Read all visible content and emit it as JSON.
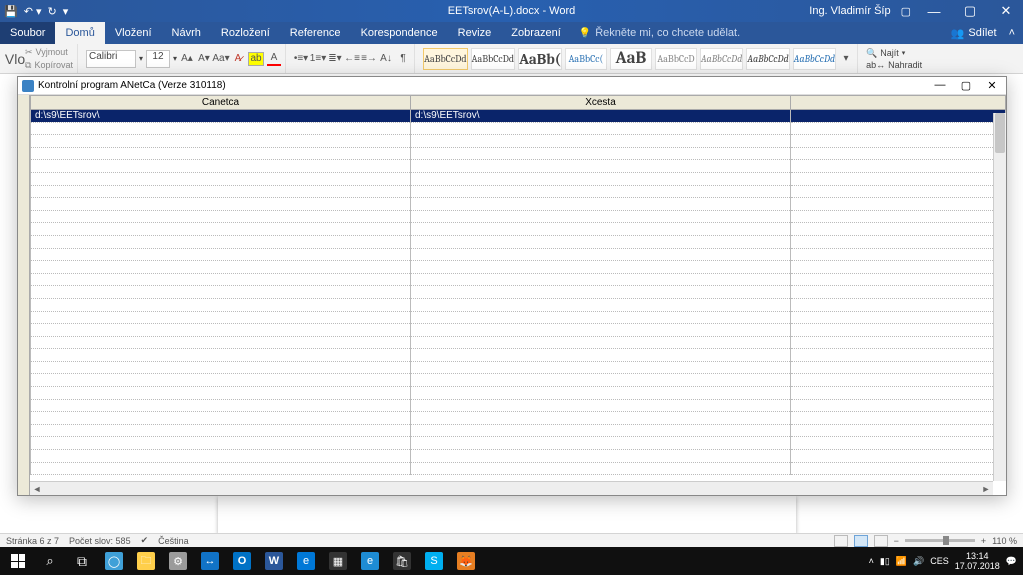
{
  "titlebar": {
    "doc_title": "EETsrov(A-L).docx - Word",
    "user_name": "Ing. Vladimír Šíp"
  },
  "menu": {
    "file": "Soubor",
    "home": "Domů",
    "insert": "Vložení",
    "design": "Návrh",
    "layout": "Rozložení",
    "references": "Reference",
    "mailings": "Korespondence",
    "review": "Revize",
    "view": "Zobrazení",
    "tell_me": "Řekněte mi, co chcete udělat.",
    "share": "Sdílet"
  },
  "ribbon": {
    "clipboard": {
      "cut": "Vyjmout",
      "copy": "Kopírovat",
      "paste_hint": "Vlo"
    },
    "font": {
      "name": "Calibri",
      "size": "12"
    },
    "styles": {
      "s1": "AaBbCcDd",
      "s2": "AaBbCcDd",
      "s3": "AaBb(",
      "s4": "AaBbCc(",
      "s5": "AaB",
      "s6": "AaBbCcD",
      "s7": "AaBbCcDd",
      "s8": "AaBbCcDd",
      "s9": "AaBbCcDd"
    },
    "editing": {
      "find": "Najít",
      "replace": "Nahradit"
    }
  },
  "prog": {
    "title": "Kontrolní program ANetCa (Verze 310118)",
    "columns": {
      "c1": "Canetca",
      "c2": "Xcesta"
    },
    "row1": {
      "c1": "d:\\s9\\EETsrov\\",
      "c2": "d:\\s9\\EETsrov\\"
    }
  },
  "statusbar": {
    "page": "Stránka 6 z 7",
    "words": "Počet slov: 585",
    "lang": "Čeština",
    "zoom": "110 %"
  },
  "tray": {
    "lang": "CES",
    "time": "13:14",
    "date": "17.07.2018"
  }
}
